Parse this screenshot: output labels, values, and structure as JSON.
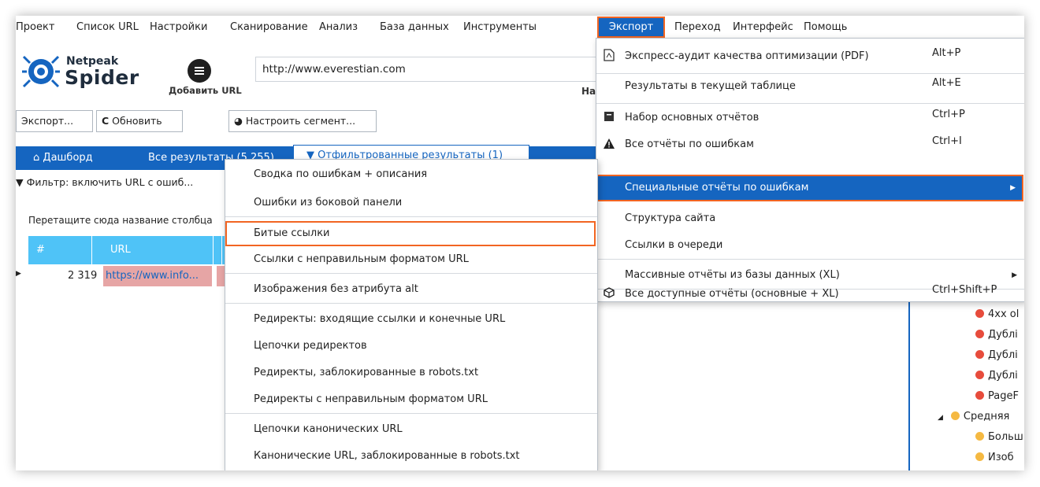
{
  "menubar": {
    "items": [
      "Проект",
      "Список URL",
      "Настройки",
      "Сканирование",
      "Анализ",
      "База данных",
      "Инструменты"
    ],
    "active": "Экспорт",
    "after": [
      "Переход",
      "Интерфейс",
      "Помощь"
    ]
  },
  "logo": {
    "line1": "Netpeak",
    "line2": "Spider"
  },
  "add_url": {
    "label": "Добавить URL"
  },
  "url_input": {
    "value": "http://www.everestian.com"
  },
  "partial_label": "На",
  "toolbar": {
    "export_label": "Экспорт...",
    "refresh_label": "Обновить",
    "segment_label": "Настроить сегмент..."
  },
  "tabs": {
    "dashboard": "Дашборд",
    "all_results": "Все результаты (5 255)",
    "filtered": "Отфильтрованные результаты (1)"
  },
  "filter_text": "Фильтр: включить URL с ошиб...",
  "drag_hint": "Перетащите сюда название столбца",
  "grid": {
    "columns": [
      "#",
      "URL"
    ],
    "rows": [
      {
        "num": "2 319",
        "url": "https://www.info..."
      }
    ]
  },
  "export_menu": {
    "items": [
      {
        "icon": "pdf",
        "label": "Экспресс-аудит качества оптимизации (PDF)",
        "shortcut": "Alt+P"
      },
      {
        "icon": "",
        "label": "Результаты в текущей таблице",
        "shortcut": "Alt+E"
      },
      {
        "icon": "box",
        "label": "Набор основных отчётов",
        "shortcut": "Ctrl+P"
      },
      {
        "icon": "warning",
        "label": "Все отчёты по ошибкам",
        "shortcut": "Ctrl+I"
      },
      {
        "icon": "",
        "label": "Специальные отчёты по ошибкам",
        "shortcut": ""
      },
      {
        "icon": "",
        "label": "Структура сайта",
        "shortcut": ""
      },
      {
        "icon": "",
        "label": "Ссылки в очереди",
        "shortcut": ""
      },
      {
        "icon": "",
        "label": "Массивные отчёты из базы данных (XL)",
        "shortcut": ""
      },
      {
        "icon": "cube",
        "label": "Все доступные отчёты (основные + XL)",
        "shortcut": "Ctrl+Shift+P"
      }
    ]
  },
  "submenu": {
    "items": [
      "Сводка по ошибкам + описания",
      "Ошибки из боковой панели",
      "Битые ссылки",
      "Ссылки с неправильным форматом URL",
      "Изображения без атрибута alt",
      "Редиректы: входящие ссылки и конечные URL",
      "Цепочки редиректов",
      "Редиректы, заблокированные в robots.txt",
      "Редиректы с неправильным форматом URL",
      "Цепочки канонических URL",
      "Канонические URL, заблокированные в robots.txt"
    ]
  },
  "tree": {
    "items": [
      "4xx ol",
      "Дублi",
      "Дублi",
      "Дублi",
      "PageF",
      "Средняя",
      "Больш",
      "Изоб"
    ]
  },
  "colors": {
    "accent": "#1565c0",
    "highlight": "#f26522",
    "grid_header": "#4fc3f7",
    "error_row": "#e6a5a5",
    "severity_high": "#e74c3c",
    "severity_medium": "#f5b942"
  }
}
